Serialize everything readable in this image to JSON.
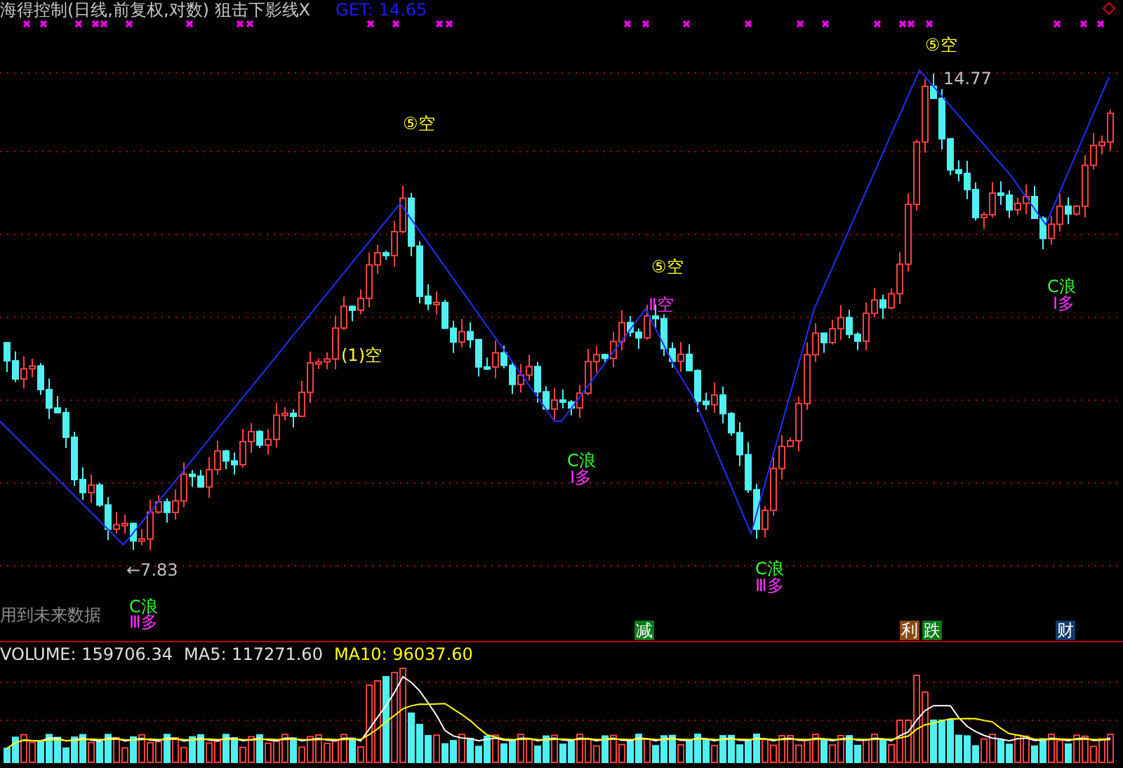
{
  "title": "海得控制(日线,前复权,对数) 狙击下影线X",
  "get_reading": "GET: 14.65",
  "price_labels": [
    "14.77",
    "←7.83"
  ],
  "signals": [
    {
      "text": "⑤空",
      "kind": "sell"
    },
    {
      "text": "⑤空",
      "kind": "sell"
    },
    {
      "text": "Ⅱ空",
      "kind": "sell2"
    },
    {
      "text": "(1)空",
      "kind": "sell"
    },
    {
      "text": "C浪",
      "kind": "wave"
    },
    {
      "text": "Ⅰ多",
      "kind": "buy"
    },
    {
      "text": "C浪",
      "kind": "wave"
    },
    {
      "text": "Ⅲ多",
      "kind": "buy"
    },
    {
      "text": "⑤空",
      "kind": "sell"
    },
    {
      "text": "C浪",
      "kind": "wave"
    },
    {
      "text": "Ⅰ多",
      "kind": "buy"
    },
    {
      "text": "C浪",
      "kind": "wave"
    },
    {
      "text": "Ⅲ多",
      "kind": "buy"
    }
  ],
  "note": "用到未来数据",
  "badges": [
    {
      "text": "减",
      "color": "#0a7a1a"
    },
    {
      "text": "利",
      "color": "#8a4a10"
    },
    {
      "text": "跌",
      "color": "#0a7a1a"
    },
    {
      "text": "财",
      "color": "#123a6a"
    }
  ],
  "volume_header": {
    "volume": "VOLUME: 159706.34",
    "ma5": "MA5: 117271.60",
    "ma10": "MA10: 96037.60"
  }
}
